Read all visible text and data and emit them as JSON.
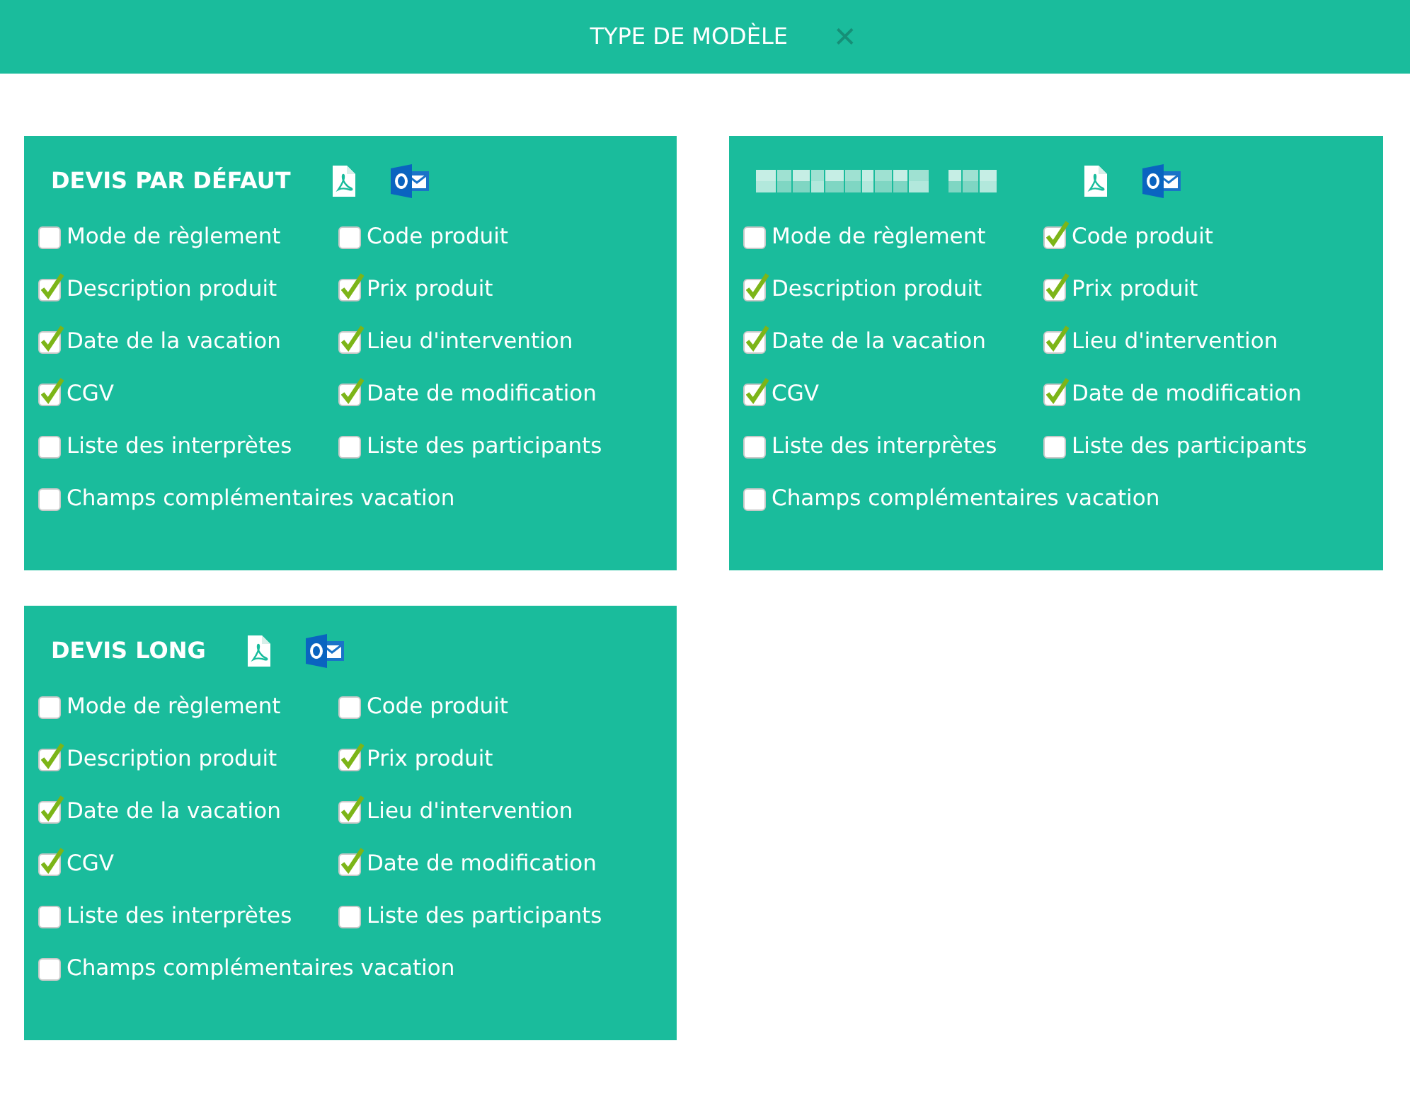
{
  "header": {
    "title": "TYPE DE MODÈLE",
    "close": "✕"
  },
  "cards": [
    {
      "title": "DEVIS PAR DÉFAUT",
      "title_redacted": false,
      "options": [
        {
          "label": "Mode de règlement",
          "checked": false
        },
        {
          "label": "Code produit",
          "checked": false
        },
        {
          "label": "Description produit",
          "checked": true
        },
        {
          "label": "Prix produit",
          "checked": true
        },
        {
          "label": "Date de la vacation",
          "checked": true
        },
        {
          "label": "Lieu d'intervention",
          "checked": true
        },
        {
          "label": "CGV",
          "checked": true
        },
        {
          "label": "Date de modification",
          "checked": true
        },
        {
          "label": "Liste des interprètes",
          "checked": false
        },
        {
          "label": "Liste des participants",
          "checked": false
        },
        {
          "label": "Champs complémentaires vacation",
          "checked": false
        }
      ]
    },
    {
      "title_redacted": true,
      "options": [
        {
          "label": "Mode de règlement",
          "checked": false
        },
        {
          "label": "Code produit",
          "checked": true
        },
        {
          "label": "Description produit",
          "checked": true
        },
        {
          "label": "Prix produit",
          "checked": true
        },
        {
          "label": "Date de la vacation",
          "checked": true
        },
        {
          "label": "Lieu d'intervention",
          "checked": true
        },
        {
          "label": "CGV",
          "checked": true
        },
        {
          "label": "Date de modification",
          "checked": true
        },
        {
          "label": "Liste des interprètes",
          "checked": false
        },
        {
          "label": "Liste des participants",
          "checked": false
        },
        {
          "label": "Champs complémentaires vacation",
          "checked": false
        }
      ]
    },
    {
      "title": "DEVIS LONG",
      "title_redacted": false,
      "options": [
        {
          "label": "Mode de règlement",
          "checked": false
        },
        {
          "label": "Code produit",
          "checked": false
        },
        {
          "label": "Description produit",
          "checked": true
        },
        {
          "label": "Prix produit",
          "checked": true
        },
        {
          "label": "Date de la vacation",
          "checked": true
        },
        {
          "label": "Lieu d'intervention",
          "checked": true
        },
        {
          "label": "CGV",
          "checked": true
        },
        {
          "label": "Date de modification",
          "checked": true
        },
        {
          "label": "Liste des interprètes",
          "checked": false
        },
        {
          "label": "Liste des participants",
          "checked": false
        },
        {
          "label": "Champs complémentaires vacation",
          "checked": false
        }
      ]
    }
  ]
}
